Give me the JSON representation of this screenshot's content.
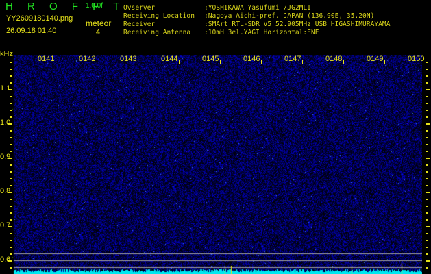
{
  "header": {
    "app_title": "H R O F F T",
    "version": "1.0.0f",
    "filename": "YY2609180140.png",
    "datetime": "26.09.18 01:40",
    "meteor_label": "meteor",
    "meteor_count": "4"
  },
  "info": [
    {
      "key": "Ovserver",
      "value": ":YOSHIKAWA Yasufumi /JG2MLI"
    },
    {
      "key": "Receiving Location",
      "value": ":Nagoya Aichi-pref. JAPAN (136.90E, 35.20N)"
    },
    {
      "key": "Receiver",
      "value": ":SMArt RTL-SDR V5 52.905MHz USB HIGASHIMURAYAMA"
    },
    {
      "key": "Receiving Antenna",
      "value": ":10mH 3el.YAGI Horizontal:ENE"
    }
  ],
  "chart_data": {
    "type": "heatmap",
    "ylabel": "kHz",
    "y_ticks": [
      "1.1",
      "1.0",
      "0.9",
      "0.8",
      "0.7",
      "0.6"
    ],
    "x_ticks": [
      "0141",
      "0142",
      "0143",
      "0144",
      "0145",
      "0146",
      "0147",
      "0148",
      "0149",
      "0150"
    ],
    "ylim": [
      0.56,
      1.2
    ],
    "colors": {
      "background": "#000010",
      "noise": "#1a1aff",
      "spectrum": "#00e8f0",
      "reference_lines": "#a0a0a0",
      "labels": "#e6e21a"
    }
  }
}
